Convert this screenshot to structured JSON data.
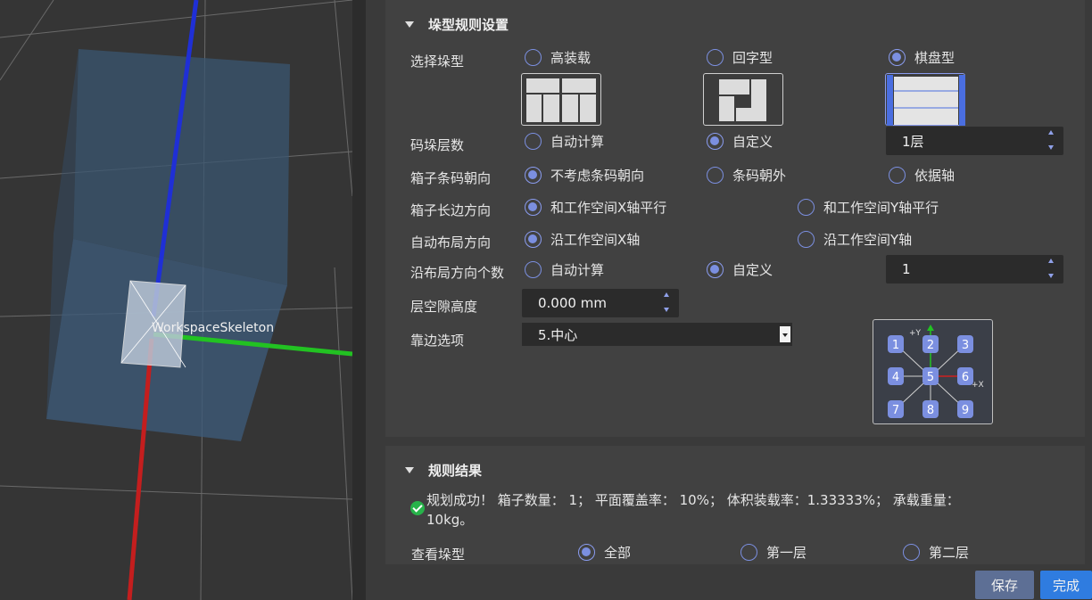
{
  "viewport": {
    "object_label": "WorkspaceSkeleton"
  },
  "rules_section": {
    "title": "垛型规则设置",
    "pattern": {
      "label": "选择垛型",
      "options": [
        "高装载",
        "回字型",
        "棋盘型"
      ],
      "selected": "棋盘型"
    },
    "layers": {
      "label": "码垛层数",
      "options": [
        "自动计算",
        "自定义"
      ],
      "selected": "自定义",
      "value": "1层"
    },
    "barcode": {
      "label": "箱子条码朝向",
      "options": [
        "不考虑条码朝向",
        "条码朝外",
        "依据轴"
      ],
      "selected": "不考虑条码朝向"
    },
    "long_side": {
      "label": "箱子长边方向",
      "options": [
        "和工作空间X轴平行",
        "和工作空间Y轴平行"
      ],
      "selected": "和工作空间X轴平行"
    },
    "layout_dir": {
      "label": "自动布局方向",
      "options": [
        "沿工作空间X轴",
        "沿工作空间Y轴"
      ],
      "selected": "沿工作空间X轴"
    },
    "count": {
      "label": "沿布局方向个数",
      "options": [
        "自动计算",
        "自定义"
      ],
      "selected": "自定义",
      "value": "1"
    },
    "gap": {
      "label": "层空隙高度",
      "value": "0.000 mm"
    },
    "edge": {
      "label": "靠边选项",
      "value": "5.中心"
    },
    "alignment_grid": {
      "cells": [
        "1",
        "4",
        "7",
        "2",
        "5",
        "8",
        "3",
        "6",
        "9"
      ],
      "axis_y": "+Y",
      "axis_x": "+X",
      "selected": "5"
    }
  },
  "result_section": {
    "title": "规则结果",
    "message_line1": "规划成功！ 箱子数量： 1； 平面覆盖率： 10%； 体积装载率：1.33333%； 承载重量：",
    "message_line2": "10kg。",
    "view": {
      "label": "查看垛型",
      "options": [
        "全部",
        "第一层",
        "第二层"
      ],
      "selected": "全部"
    }
  },
  "buttons": {
    "save": "保存",
    "done": "完成"
  },
  "colors": {
    "accent": "#7b8fe0",
    "primary_button": "#2f7ce0",
    "secondary_button": "#5d6f95",
    "success": "#27b34a"
  }
}
